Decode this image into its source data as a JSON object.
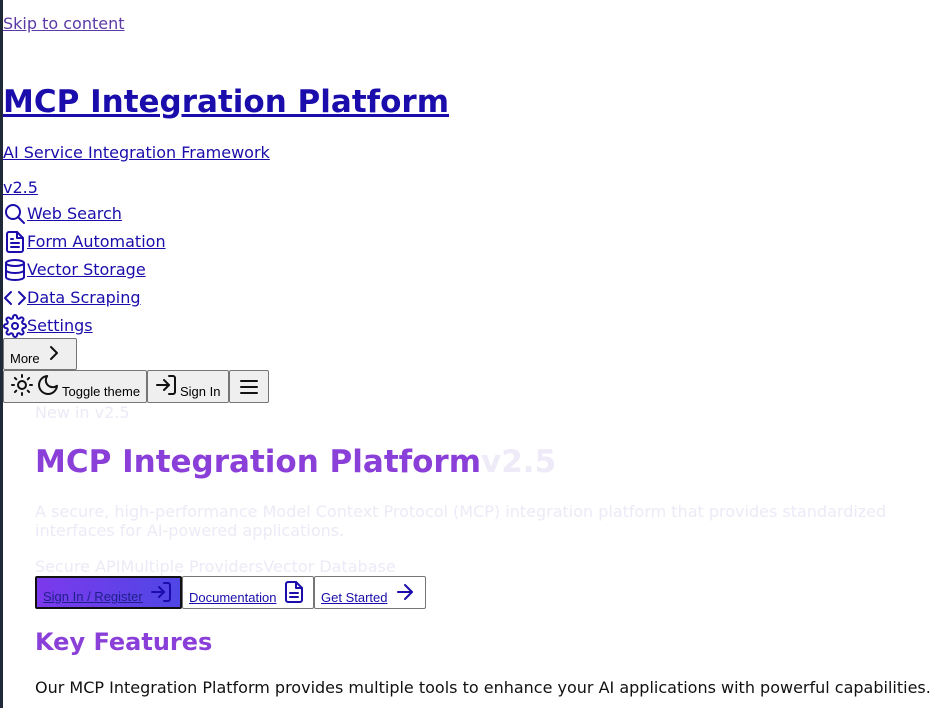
{
  "skip_link": "Skip to content",
  "site": {
    "title": "MCP Integration Platform",
    "subtitle": "AI Service Integration Framework",
    "version": "v2.5"
  },
  "nav": {
    "items": [
      {
        "label": "Web Search",
        "icon": "search-icon"
      },
      {
        "label": "Form Automation",
        "icon": "document-icon"
      },
      {
        "label": "Vector Storage",
        "icon": "database-icon"
      },
      {
        "label": "Data Scraping",
        "icon": "code-icon"
      },
      {
        "label": "Settings",
        "icon": "gear-icon"
      }
    ],
    "more_label": "More"
  },
  "toolbar": {
    "theme_label": "Toggle theme",
    "sign_in_label": "Sign In"
  },
  "hero": {
    "badge": "New in v2.5",
    "title": "MCP Integration Platform",
    "version": "v2.5",
    "description": "A secure, high-performance Model Context Protocol (MCP) integration platform that provides standardized interfaces for AI-powered applications.",
    "tags": [
      "Secure API",
      "Multiple Providers",
      "Vector Database"
    ]
  },
  "cta": {
    "primary_label": "Sign In / Register",
    "docs_label": "Documentation",
    "start_label": "Get Started"
  },
  "features": {
    "title": "Key Features",
    "description": "Our MCP Integration Platform provides multiple tools to enhance your AI applications with powerful capabilities."
  },
  "colors": {
    "accent": "#8a3fd8",
    "link": "#1a0dab",
    "gradient_start": "#7c3aed",
    "gradient_end": "#4f46e5"
  }
}
